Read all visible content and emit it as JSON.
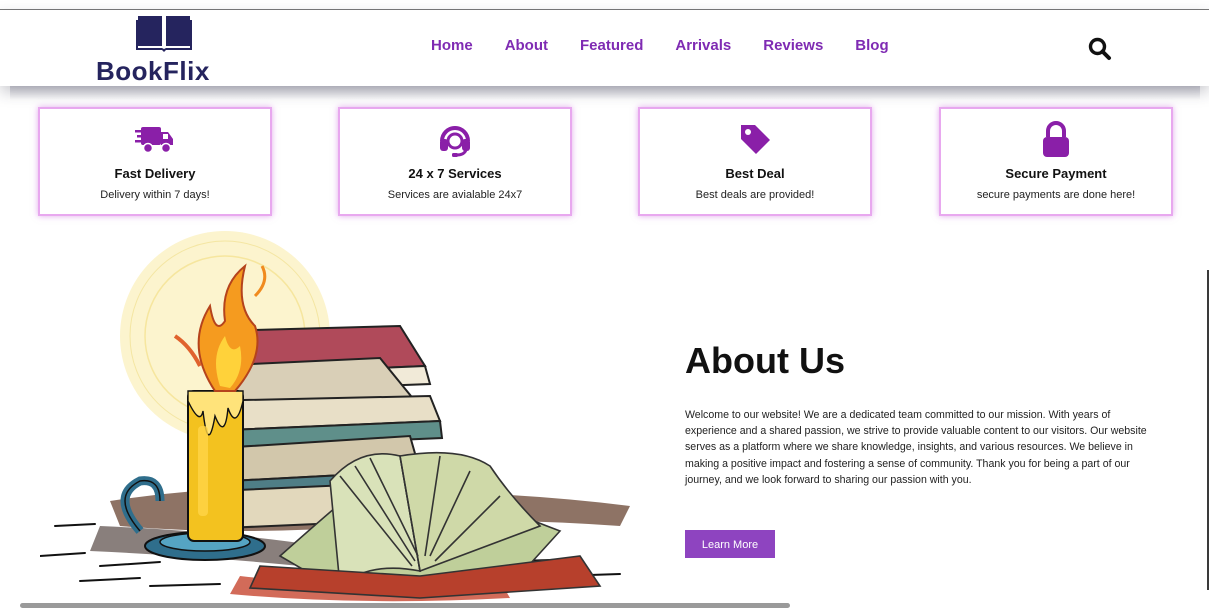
{
  "brand": {
    "name": "BookFlix",
    "logo_icon": "open-book-icon",
    "color": "#25245e"
  },
  "nav": {
    "items": [
      {
        "label": "Home"
      },
      {
        "label": "About"
      },
      {
        "label": "Featured"
      },
      {
        "label": "Arrivals"
      },
      {
        "label": "Reviews"
      },
      {
        "label": "Blog"
      }
    ],
    "accent": "#7f2bb3"
  },
  "search": {
    "icon": "search-icon"
  },
  "features": [
    {
      "icon": "truck-icon",
      "title": "Fast Delivery",
      "desc": "Delivery within 7 days!"
    },
    {
      "icon": "headset-icon",
      "title": "24 x 7 Services",
      "desc": "Services are avialable 24x7"
    },
    {
      "icon": "tag-icon",
      "title": "Best Deal",
      "desc": "Best deals are provided!"
    },
    {
      "icon": "lock-icon",
      "title": "Secure Payment",
      "desc": "secure payments are done here!"
    }
  ],
  "about": {
    "title": "About Us",
    "text": "Welcome to our website! We are a dedicated team committed to our mission. With years of experience and a shared passion, we strive to provide valuable content to our visitors. Our website serves as a platform where we share knowledge, insights, and various resources. We believe in making a positive impact and fostering a sense of community. Thank you for being a part of our journey, and we look forward to sharing our passion with you.",
    "button": "Learn More",
    "button_color": "#8e44c0"
  },
  "colors": {
    "card_border": "#e8a8ef",
    "icon_purple": "#8a1fa8"
  }
}
